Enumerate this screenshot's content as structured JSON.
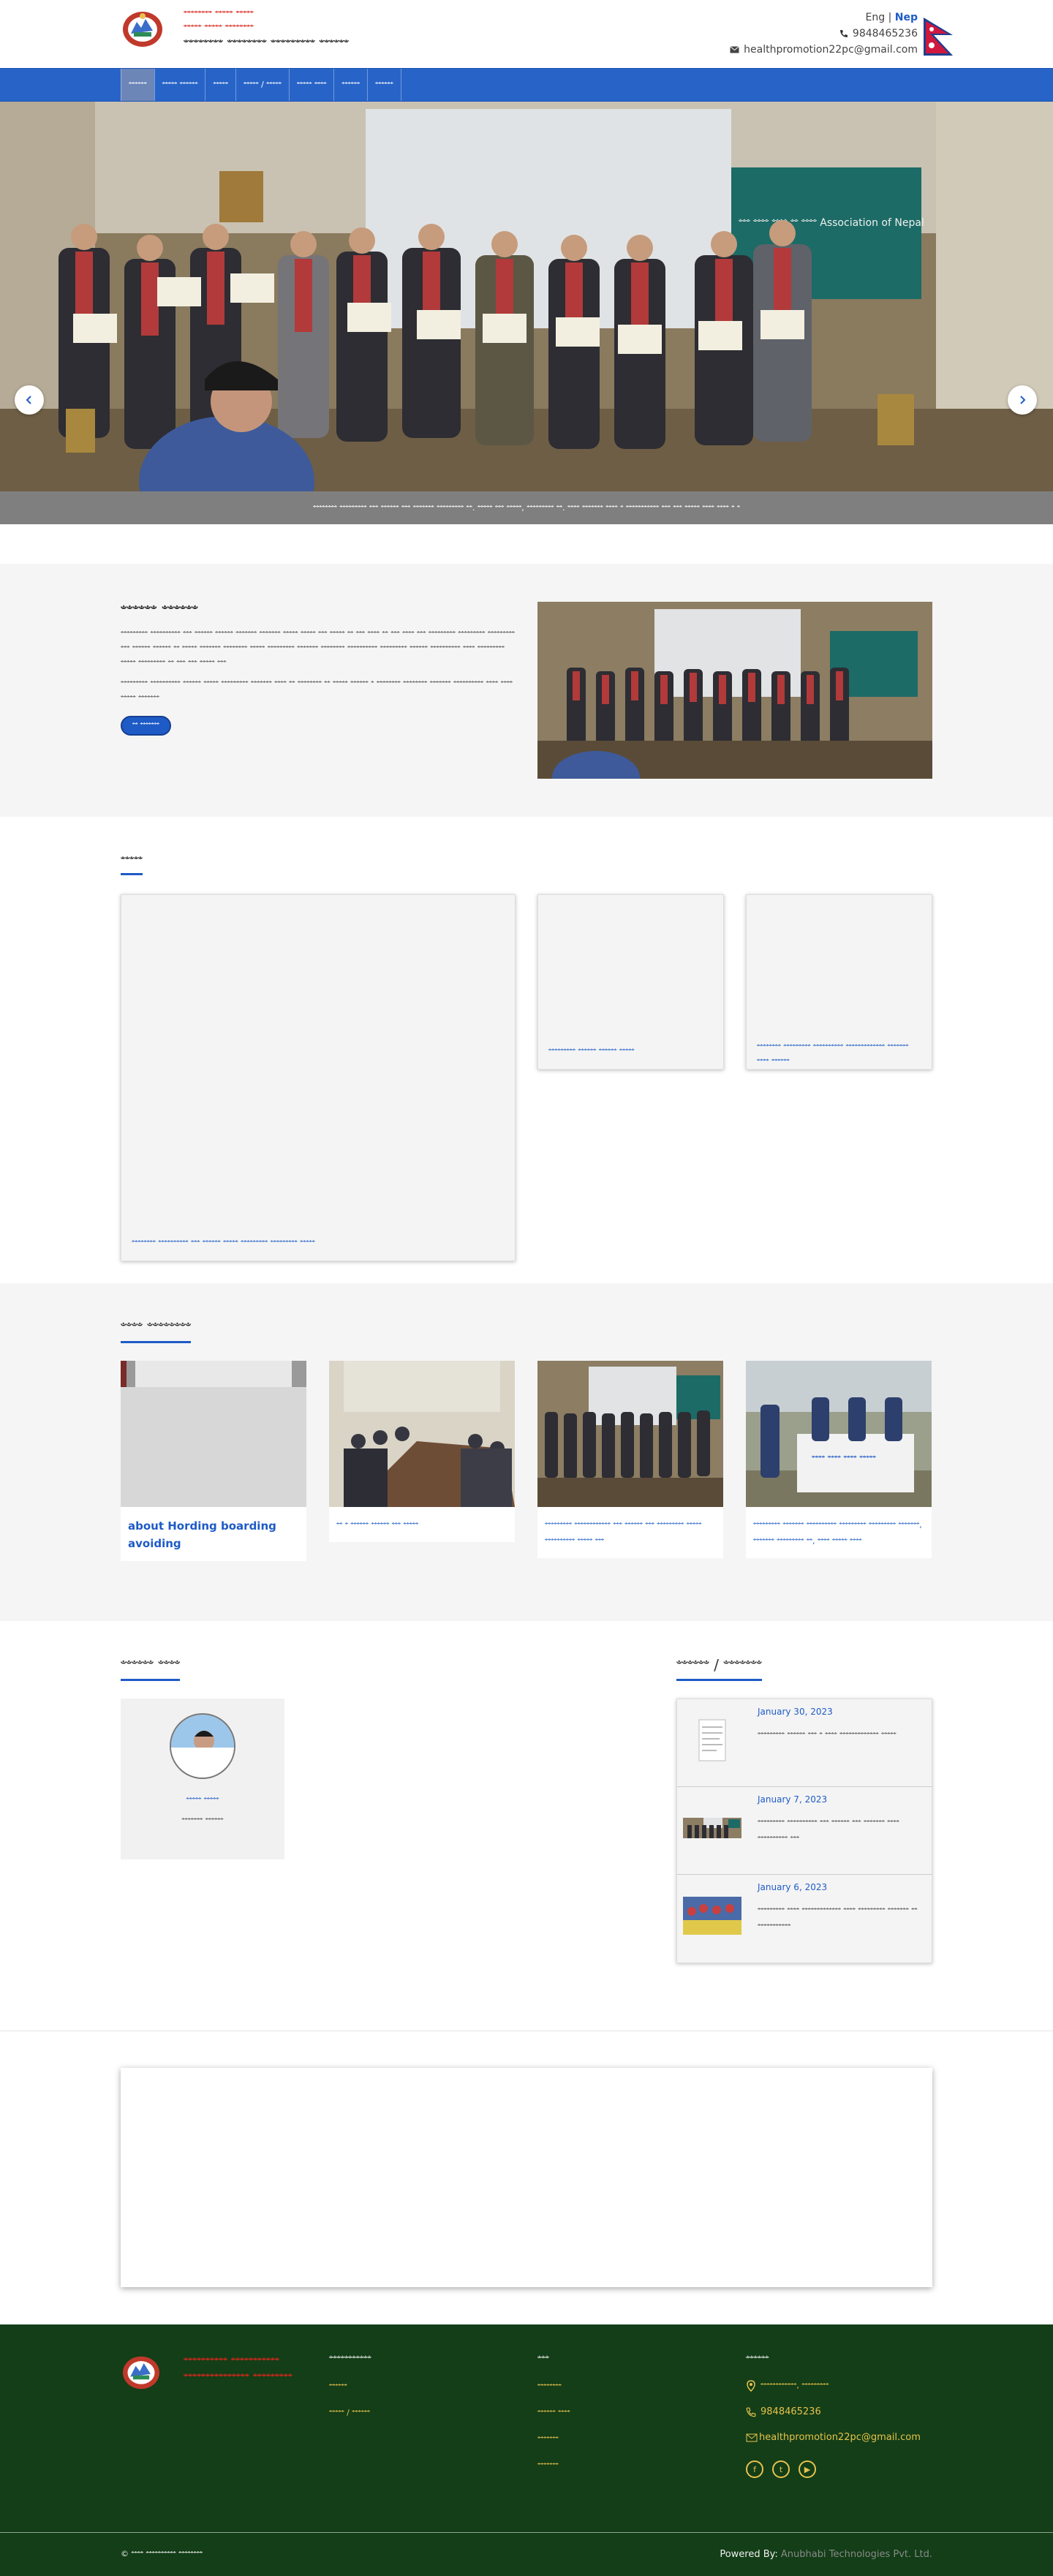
{
  "header": {
    "brand_line1": "ꣲꣲꣲꣲꣲꣲꣲꣲ ꣲꣲꣲꣲꣲ ꣲꣲꣲꣲꣲ",
    "brand_line2": "ꣲꣲꣲꣲꣲ ꣲꣲꣲꣲꣲ ꣲꣲꣲꣲꣲꣲꣲꣲ",
    "brand_line3": "ꣲꣲꣲꣲꣲꣲꣲꣲ ꣲꣲꣲꣲꣲꣲꣲꣲ ꣲꣲꣲꣲꣲꣲꣲꣲꣲ ꣲꣲꣲꣲꣲꣲ",
    "lang_eng": "Eng",
    "lang_sep": " | ",
    "lang_nep": "Nep",
    "phone": "9848465236",
    "email": "healthpromotion22pc@gmail.com"
  },
  "nav": {
    "items": [
      "ꣲꣲꣲꣲꣲꣲ",
      "ꣲꣲꣲꣲꣲ ꣲꣲꣲꣲꣲꣲ",
      "ꣲꣲꣲꣲꣲ",
      "ꣲꣲꣲꣲꣲ / ꣲꣲꣲꣲꣲ",
      "ꣲꣲꣲꣲꣲ ꣲꣲꣲꣲ",
      "ꣲꣲꣲꣲꣲꣲ",
      "ꣲꣲꣲꣲꣲꣲ"
    ]
  },
  "hero": {
    "caption": "ꣲꣲꣲꣲꣲꣲꣲꣲ ꣲꣲꣲꣲꣲꣲꣲꣲꣲ ꣲꣲꣲ ꣲꣲꣲꣲꣲꣲ ꣲꣲꣲ ꣲꣲꣲꣲꣲꣲꣲ ꣲꣲꣲꣲꣲꣲꣲꣲꣲ ꣲꣲ. ꣲꣲꣲꣲꣲ ꣲꣲꣲ ꣲꣲꣲꣲꣲ, ꣲꣲꣲꣲꣲꣲꣲꣲꣲ ꣲꣲ. ꣲꣲꣲꣲ ꣲꣲꣲꣲꣲꣲꣲ ꣲꣲꣲꣲ ꣲ ꣲꣲꣲꣲꣲꣲꣲꣲꣲꣲꣲ ꣲꣲꣲ ꣲꣲꣲ ꣲꣲꣲꣲꣲ ꣲꣲꣲꣲ ꣲꣲꣲꣲ ꣲ ꣲ",
    "banner_text": "ꣲꣲꣲ ꣲꣲꣲꣲ ꣲꣲꣲꣲ ꣲꣲ ꣲꣲꣲꣲ Association of Nepal"
  },
  "about": {
    "title": "ꣲꣲꣲꣲꣲꣲ ꣲꣲꣲꣲꣲꣲ",
    "para1": "ꣲꣲꣲꣲꣲꣲꣲꣲꣲ ꣲꣲꣲꣲꣲꣲꣲꣲꣲꣲ ꣲꣲꣲ ꣲꣲꣲꣲꣲꣲ ꣲꣲꣲꣲꣲꣲ ꣲꣲꣲꣲꣲꣲꣲ ꣲꣲꣲꣲꣲꣲꣲ ꣲꣲꣲꣲꣲ ꣲꣲꣲꣲꣲ ꣲꣲꣲ ꣲꣲꣲꣲꣲ ꣲꣲ ꣲꣲꣲ ꣲꣲꣲꣲ ꣲꣲ  ꣲꣲꣲ ꣲꣲꣲꣲ ꣲꣲꣲ ꣲꣲꣲꣲꣲꣲꣲꣲꣲ ꣲꣲꣲꣲꣲꣲꣲꣲꣲ ꣲꣲꣲꣲꣲꣲꣲꣲꣲ ꣲꣲꣲ ꣲꣲꣲꣲꣲꣲ ꣲꣲꣲꣲꣲꣲ ꣲꣲ ꣲꣲꣲꣲꣲ ꣲꣲꣲꣲꣲꣲꣲ ꣲꣲꣲꣲꣲꣲꣲꣲ ꣲꣲꣲꣲꣲ ꣲꣲꣲꣲꣲꣲꣲꣲꣲ ꣲꣲꣲꣲꣲꣲꣲ  ꣲꣲꣲꣲꣲꣲꣲꣲ ꣲꣲꣲꣲꣲꣲꣲꣲꣲꣲ ꣲꣲꣲꣲꣲꣲꣲꣲꣲ ꣲꣲꣲꣲꣲꣲ ꣲꣲꣲꣲꣲꣲꣲꣲꣲꣲ ꣲꣲꣲꣲ ꣲꣲꣲꣲꣲꣲꣲꣲꣲ ꣲꣲꣲꣲꣲ ꣲꣲꣲꣲꣲꣲꣲꣲꣲ ꣲꣲ ꣲꣲꣲ ꣲꣲꣲ ꣲꣲꣲꣲꣲ ꣲꣲꣲ",
    "para2": "ꣲꣲꣲꣲꣲꣲꣲꣲꣲ ꣲꣲꣲꣲꣲꣲꣲꣲꣲꣲ ꣲꣲꣲꣲꣲꣲ ꣲꣲꣲꣲꣲ ꣲꣲꣲꣲꣲꣲꣲꣲꣲ ꣲꣲꣲꣲꣲꣲꣲ ꣲꣲꣲꣲ ꣲꣲ ꣲꣲꣲꣲꣲꣲꣲꣲ ꣲꣲ ꣲꣲꣲꣲꣲ ꣲꣲꣲꣲꣲꣲ ꣲ ꣲꣲꣲꣲꣲꣲꣲꣲ ꣲꣲꣲꣲꣲꣲꣲꣲ ꣲꣲꣲꣲꣲꣲꣲ ꣲꣲꣲꣲꣲꣲꣲꣲꣲꣲ ꣲꣲꣲꣲ ꣲꣲꣲꣲ ꣲꣲꣲꣲꣲ ꣲꣲꣲꣲꣲꣲꣲ",
    "button": "ꣲꣲ ꣲꣲꣲꣲꣲꣲꣲ"
  },
  "news": {
    "title": "ꣲꣲꣲꣲꣲ",
    "cards": [
      "ꣲꣲꣲꣲꣲꣲꣲꣲ ꣲꣲꣲꣲꣲꣲꣲꣲꣲꣲ ꣲꣲꣲ ꣲꣲꣲꣲꣲꣲ ꣲꣲꣲꣲꣲ ꣲꣲꣲꣲꣲꣲꣲꣲꣲ ꣲꣲꣲꣲꣲꣲꣲꣲꣲ ꣲꣲꣲꣲꣲ",
      "ꣲꣲꣲꣲꣲꣲꣲꣲꣲ ꣲꣲꣲꣲꣲꣲ ꣲꣲꣲꣲꣲꣲ ꣲꣲꣲꣲꣲ",
      "ꣲꣲꣲꣲꣲꣲꣲꣲ ꣲꣲꣲꣲꣲꣲꣲꣲꣲ ꣲꣲꣲꣲꣲꣲꣲꣲꣲꣲ ꣲꣲꣲꣲꣲꣲꣲꣲꣲꣲꣲꣲꣲ ꣲꣲꣲꣲꣲꣲꣲ ꣲꣲꣲꣲ ꣲꣲꣲꣲꣲꣲ"
    ]
  },
  "activities": {
    "title": "ꣲꣲꣲꣲ ꣲꣲꣲꣲꣲꣲꣲꣲ",
    "items": [
      "about Hording boarding avoiding",
      "ꣲꣲ ꣲ ꣲꣲꣲꣲꣲꣲ ꣲꣲꣲꣲꣲꣲ ꣲꣲꣲ ꣲꣲꣲꣲꣲ",
      "ꣲꣲꣲꣲꣲꣲꣲꣲꣲ ꣲꣲꣲꣲꣲꣲꣲꣲꣲꣲꣲꣲ ꣲꣲꣲ ꣲꣲꣲꣲꣲꣲ ꣲꣲꣲ ꣲꣲꣲꣲꣲꣲꣲꣲꣲ ꣲꣲꣲꣲꣲ ꣲꣲꣲꣲꣲꣲꣲꣲꣲꣲ ꣲꣲꣲꣲꣲ ꣲꣲꣲ",
      "ꣲꣲꣲꣲꣲꣲꣲꣲꣲ ꣲꣲꣲꣲꣲꣲꣲ ꣲꣲꣲꣲꣲꣲꣲꣲꣲꣲ ꣲꣲꣲꣲꣲꣲꣲꣲꣲ ꣲꣲꣲꣲꣲꣲꣲꣲꣲ ꣲꣲꣲꣲꣲꣲꣲ, ꣲꣲꣲꣲꣲꣲꣲ ꣲꣲꣲꣲꣲꣲꣲꣲꣲ ꣲꣲ, ꣲꣲꣲꣲ ꣲꣲꣲꣲꣲ ꣲꣲꣲꣲ"
    ],
    "banner_text": "ꣲꣲꣲꣲ ꣲꣲꣲꣲ ꣲꣲꣲꣲ ꣲꣲꣲꣲꣲ"
  },
  "staff": {
    "title": "ꣲꣲꣲꣲꣲꣲ ꣲꣲꣲꣲ",
    "name": "ꣲꣲꣲꣲꣲ ꣲꣲꣲꣲꣲ",
    "role": "ꣲꣲꣲꣲꣲꣲꣲ ꣲꣲꣲꣲꣲꣲ"
  },
  "notices": {
    "title": "ꣲꣲꣲꣲꣲꣲ / ꣲꣲꣲꣲꣲꣲꣲ",
    "items": [
      {
        "date": "January 30, 2023",
        "text": "ꣲꣲꣲꣲꣲꣲꣲꣲꣲ ꣲꣲꣲꣲꣲꣲ ꣲꣲꣲ ꣲ ꣲꣲꣲꣲ ꣲꣲꣲꣲꣲꣲꣲꣲꣲꣲꣲꣲꣲ ꣲꣲꣲꣲꣲ"
      },
      {
        "date": "January 7, 2023",
        "text": "ꣲꣲꣲꣲꣲꣲꣲꣲꣲ ꣲꣲꣲꣲꣲꣲꣲꣲꣲꣲ ꣲꣲꣲ ꣲꣲꣲꣲꣲꣲ ꣲꣲꣲ ꣲꣲꣲꣲꣲꣲꣲ ꣲꣲꣲꣲ ꣲꣲꣲꣲꣲꣲꣲꣲꣲꣲ ꣲꣲꣲ"
      },
      {
        "date": "January 6, 2023",
        "text": "ꣲꣲꣲꣲꣲꣲꣲꣲꣲ ꣲꣲꣲꣲ ꣲꣲꣲꣲꣲꣲꣲꣲꣲꣲꣲꣲꣲ ꣲꣲꣲꣲ ꣲꣲꣲꣲꣲꣲꣲꣲꣲ ꣲꣲꣲꣲꣲꣲꣲ ꣲꣲ ꣲꣲꣲꣲꣲꣲꣲꣲꣲꣲꣲ"
      }
    ]
  },
  "footer": {
    "brand": "ꣲꣲꣲꣲꣲꣲꣲꣲꣲꣲ ꣲꣲꣲꣲꣲꣲꣲꣲꣲꣲꣲ ꣲꣲꣲꣲꣲꣲꣲꣲꣲꣲꣲꣲꣲꣲꣲ ꣲꣲꣲꣲꣲꣲꣲꣲꣲ",
    "col1_title": "ꣲꣲꣲꣲꣲꣲꣲꣲꣲꣲꣲ",
    "col1_links": [
      "ꣲꣲꣲꣲꣲꣲ",
      "ꣲꣲꣲꣲꣲ / ꣲꣲꣲꣲꣲꣲ"
    ],
    "col2_title": "ꣲꣲꣲ",
    "col2_links": [
      "ꣲꣲꣲꣲꣲꣲꣲꣲ",
      "ꣲꣲꣲꣲꣲꣲ ꣲꣲꣲꣲ",
      "ꣲꣲꣲꣲꣲꣲꣲ",
      "ꣲꣲꣲꣲꣲꣲꣲ"
    ],
    "col3_title": "ꣲꣲꣲꣲꣲꣲ",
    "address": "ꣲꣲꣲꣲꣲꣲꣲꣲꣲꣲꣲꣲ, ꣲꣲꣲꣲꣲꣲꣲꣲꣲ",
    "phone": "9848465236",
    "email": "healthpromotion22pc@gmail.com",
    "copyright": "© ꣲꣲꣲꣲ ꣲꣲꣲꣲꣲꣲꣲꣲꣲꣲ ꣲꣲꣲꣲꣲꣲꣲꣲ",
    "powered_label": "Powered By:",
    "powered_by": "Anubhabi Technologies Pvt. Ltd."
  },
  "colors": {
    "nav": "#2864c8",
    "accent": "#1e5bc6",
    "brand_red": "#d9261c",
    "footer_bg": "#133e17",
    "footer_link": "#e8c14d"
  }
}
